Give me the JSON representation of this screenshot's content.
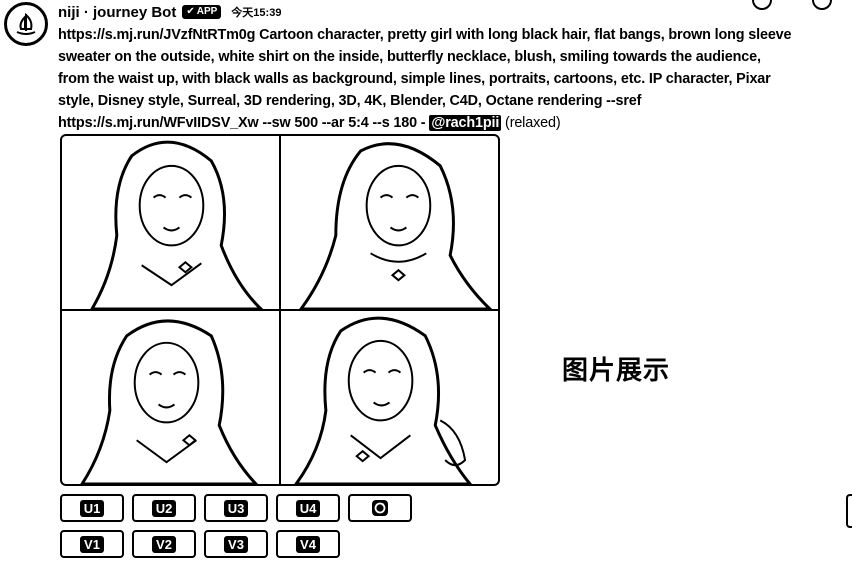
{
  "header": {
    "username": "niji · journey Bot",
    "badge": "APP",
    "timestamp": "今天15:39"
  },
  "message": {
    "text": "https://s.mj.run/JVzfNtRTm0g Cartoon character, pretty girl with long black hair, flat bangs, brown long sleeve sweater on the outside, white shirt on the inside, butterfly necklace, blush, smiling towards the audience, from the waist up, with black walls as background, simple lines, portraits, cartoons, etc. IP character, Pixar style, Disney style, Surreal, 3D rendering, 3D, 4K, Blender, C4D, Octane rendering --sref https://s.mj.run/WFvIIDSV_Xw --sw 500 --ar 5:4 --s 180 -",
    "mention": "@rach1pii",
    "mode": "(relaxed)"
  },
  "showcase_label": "图片展示",
  "upscale_buttons": [
    "U1",
    "U2",
    "U3",
    "U4"
  ],
  "variation_buttons": [
    "V1",
    "V2",
    "V3",
    "V4"
  ],
  "icons": {
    "avatar": "sailboat-icon",
    "badge": "check-icon",
    "reroll": "refresh-icon"
  }
}
